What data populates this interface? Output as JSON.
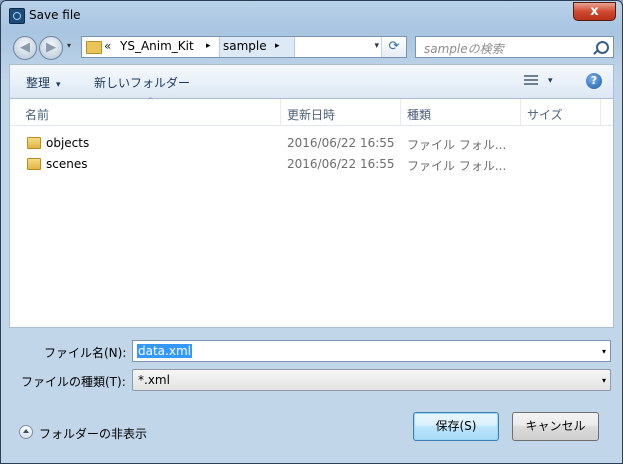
{
  "window": {
    "title": "Save file",
    "close_glyph": "x"
  },
  "nav": {
    "back_icon": "back-arrow-icon",
    "forward_icon": "forward-arrow-icon",
    "back_glyph": "◀",
    "forward_glyph": "▶",
    "history_glyph": "▾",
    "breadcrumb_overflow": "«",
    "breadcrumbs": [
      "YS_Anim_Kit",
      "sample"
    ],
    "crumb_arrow": "▸",
    "dropdown_glyph": "▾",
    "refresh_glyph": "⟳",
    "search_placeholder": "sampleの検索"
  },
  "toolbar": {
    "organize_label": "整理",
    "new_folder_label": "新しいフォルダー",
    "dropdown_glyph": "▾",
    "help_glyph": "?"
  },
  "filelist": {
    "sort_glyph": "^",
    "columns": {
      "name": "名前",
      "modified": "更新日時",
      "type": "種類",
      "size": "サイズ"
    },
    "rows": [
      {
        "name": "objects",
        "modified": "2016/06/22 16:55",
        "type": "ファイル フォル..."
      },
      {
        "name": "scenes",
        "modified": "2016/06/22 16:55",
        "type": "ファイル フォル..."
      }
    ]
  },
  "form": {
    "filename_label": "ファイル名(N):",
    "filename_value": "data.xml",
    "filetype_label": "ファイルの種類(T):",
    "filetype_value": "*.xml",
    "dropdown_glyph": "▾"
  },
  "footer": {
    "hide_folders_label": "フォルダーの非表示",
    "save_label": "保存(S)",
    "cancel_label": "キャンセル"
  },
  "colors": {
    "selection": "#3399ff",
    "window_frame": "#a8c4e0",
    "close_button": "#d04a2f"
  }
}
